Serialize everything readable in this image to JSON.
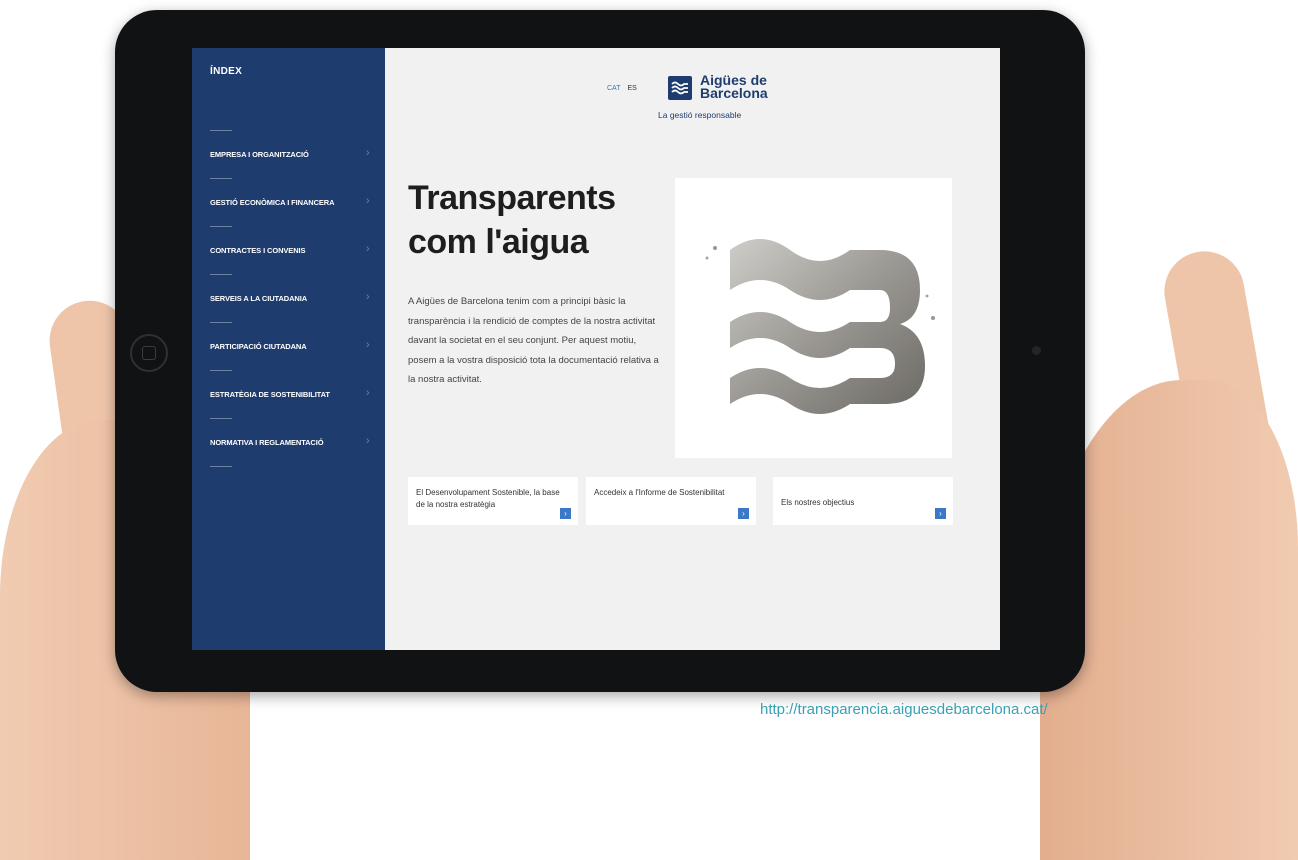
{
  "sidebar": {
    "index_title": "ÍNDEX",
    "items": [
      {
        "label": "EMPRESA I ORGANITZACIÓ"
      },
      {
        "label": "GESTIÓ ECONÒMICA I FINANCERA"
      },
      {
        "label": "CONTRACTES I CONVENIS"
      },
      {
        "label": "SERVEIS A LA CIUTADANIA"
      },
      {
        "label": "PARTICIPACIÓ CIUTADANA"
      },
      {
        "label": "ESTRATÈGIA DE SOSTENIBILITAT"
      },
      {
        "label": "NORMATIVA I REGLAMENTACIÓ"
      }
    ]
  },
  "header": {
    "lang_cat": "CAT",
    "lang_es": "ES",
    "logo_name": "Aigües de Barcelona",
    "logo_tagline": "La gestió responsable"
  },
  "hero": {
    "title": "Transparents com l'aigua",
    "body": "A Aigües de Barcelona tenim com a principi bàsic la transparència i la rendició de comptes de la nostra activitat davant la societat en el seu conjunt. Per aquest motiu, posem a la vostra disposició tota la documentació relativa a la nostra activitat."
  },
  "cards": [
    {
      "text": "El Desenvolupament Sostenible, la base de la nostra estratègia"
    },
    {
      "text": "Accedeix a l'Informe de Sostenibilitat"
    },
    {
      "text": "Els nostres objectius"
    }
  ],
  "footer_url": "http://transparencia.aiguesdebarcelona.cat/",
  "colors": {
    "sidebar": "#1f3c6e",
    "accent": "#3a79c7",
    "url": "#3aa0b4"
  }
}
